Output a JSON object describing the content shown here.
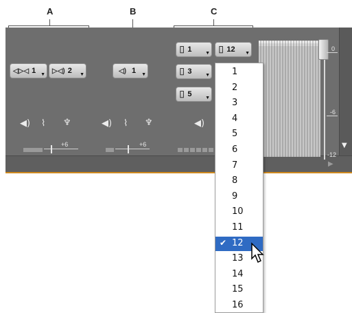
{
  "callouts": [
    "A",
    "B",
    "C"
  ],
  "track_buttons": {
    "a1": {
      "icon": "stereo-speaker-icon",
      "glyph": "◁▷◁",
      "value": "1"
    },
    "a2": {
      "icon": "speaker-right-icon",
      "glyph": "▷◁)",
      "value": "2"
    },
    "b1": {
      "icon": "mono-speaker-icon",
      "glyph": "◁)",
      "value": "1"
    },
    "c1": {
      "icon": "channel-icon",
      "glyph": "⌷",
      "value": "1"
    },
    "c12": {
      "icon": "channel-icon",
      "glyph": "⌷",
      "value": "12"
    },
    "c3": {
      "icon": "channel-icon",
      "glyph": "⌷",
      "value": "3"
    },
    "c5": {
      "icon": "channel-icon",
      "glyph": "⌷",
      "value": "5"
    }
  },
  "fader_labels": {
    "a": "+6",
    "b": "+6"
  },
  "meter_scale": {
    "zero": "0",
    "minus6": "-6",
    "minus12": "-12"
  },
  "dropdown": {
    "options": [
      "1",
      "2",
      "3",
      "4",
      "5",
      "6",
      "7",
      "8",
      "9",
      "10",
      "11",
      "12",
      "13",
      "14",
      "15",
      "16"
    ],
    "selected": "12",
    "check": "✔"
  },
  "colors": {
    "panel": "#6e6e6e",
    "selection": "#2f6bc3",
    "accent_line": "#d08a1e"
  }
}
